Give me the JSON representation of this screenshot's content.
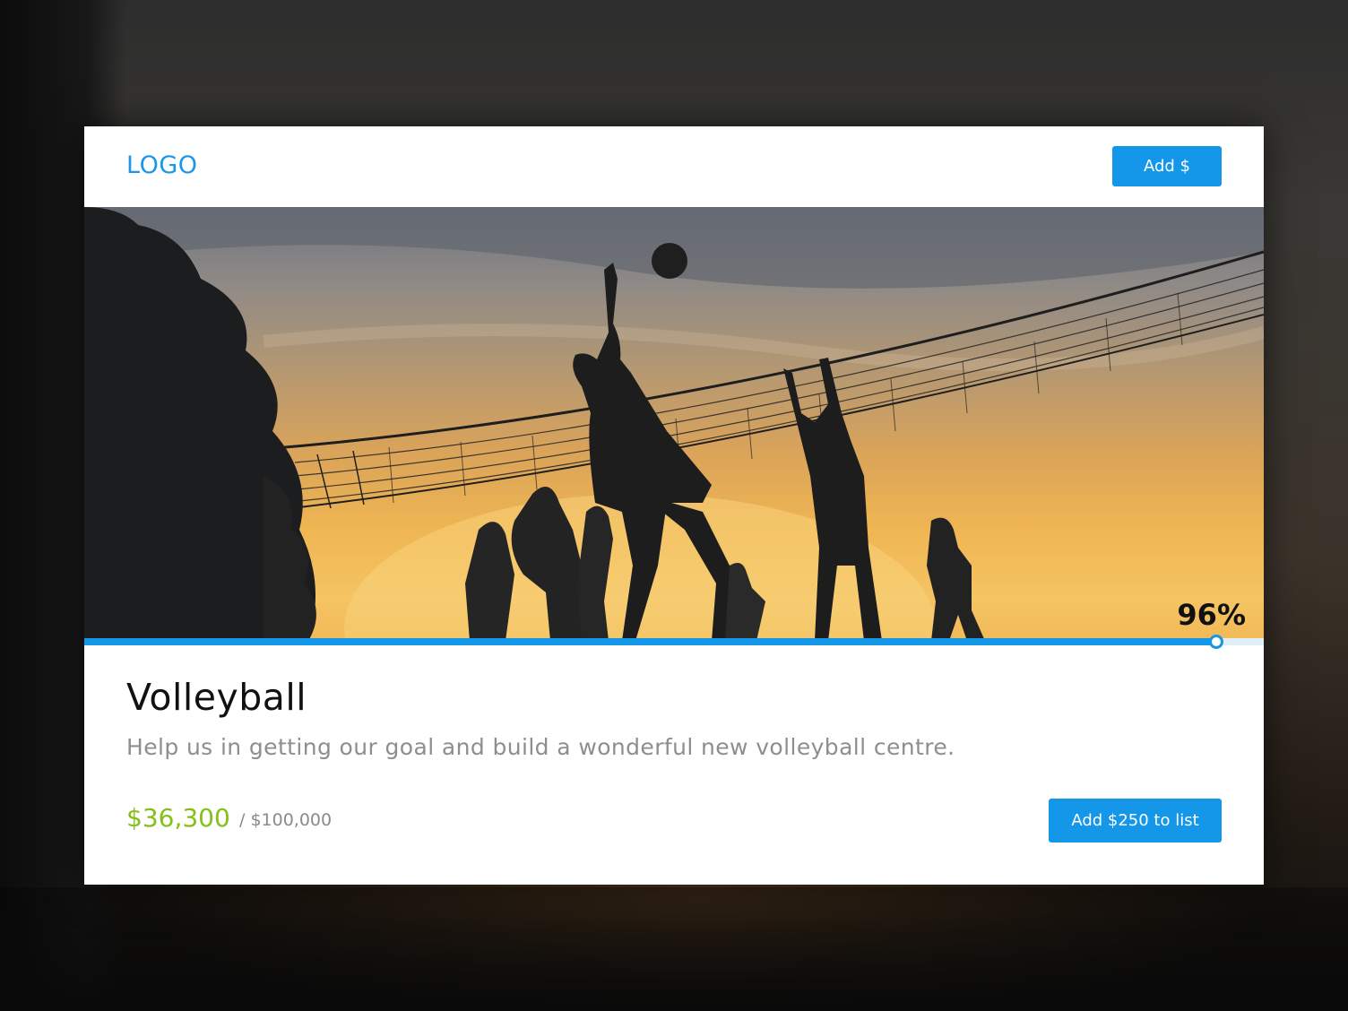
{
  "header": {
    "logo": "LOGO",
    "add_button_label": "Add $"
  },
  "campaign": {
    "title": "Volleyball",
    "description": "Help us in getting our goal and build a wonderful new volleyball centre.",
    "raised": "$36,300",
    "goal": "/ $100,000",
    "progress_percent": 96,
    "progress_label": "96%",
    "add_button_label": "Add $250 to list"
  },
  "colors": {
    "accent": "#1497e8",
    "raised": "#84c01a"
  },
  "icons": {
    "progress_handle": "circle-handle"
  }
}
